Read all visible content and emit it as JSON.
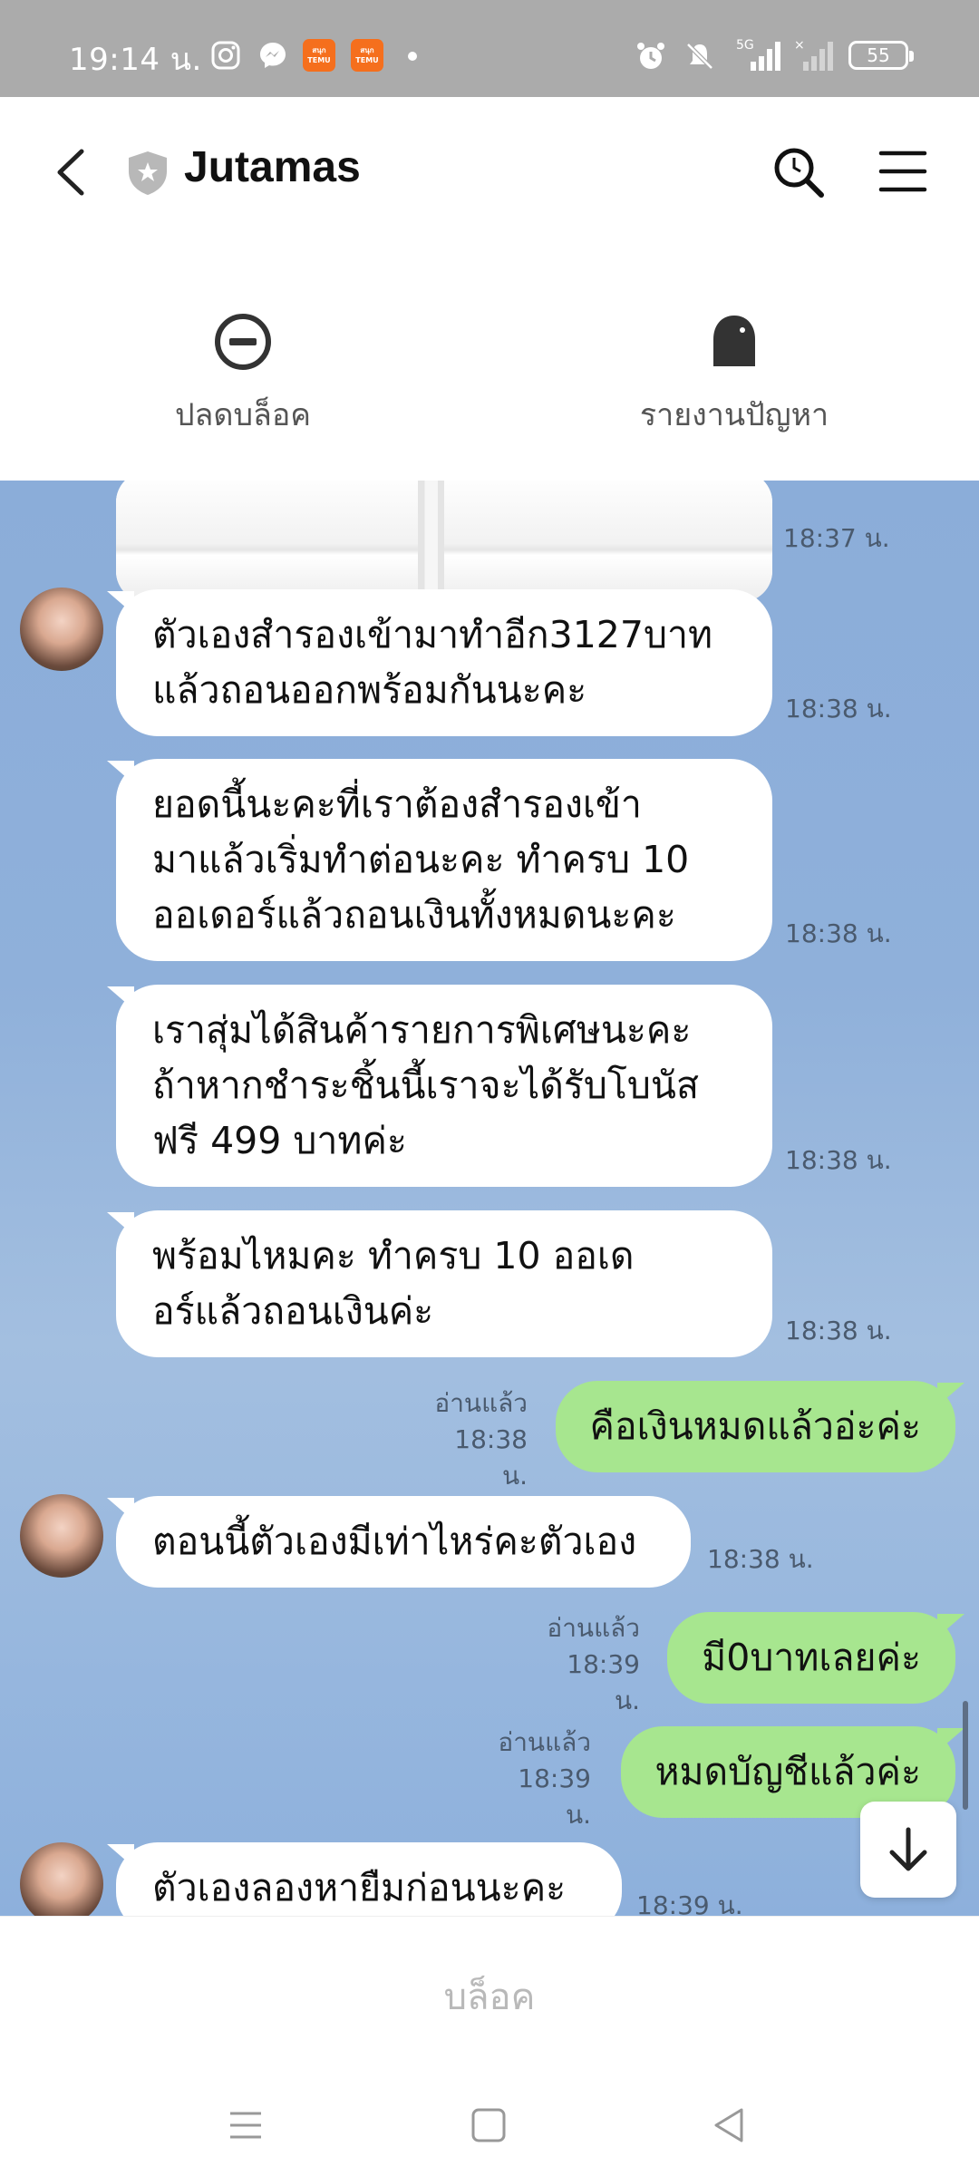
{
  "status_bar": {
    "time": "19:14 น.",
    "battery": "55",
    "network": "5G",
    "temu_label": "สนุกTEMU"
  },
  "header": {
    "title": "Jutamas"
  },
  "actions": {
    "unblock_label": "ปลดบล็อค",
    "report_label": "รายงานปัญหา"
  },
  "messages": [
    {
      "type": "image",
      "time": "18:37 น."
    },
    {
      "type": "in",
      "lines": [
        "ตัวเองสำรองเข้ามาทำอีก3127บาท",
        "แล้วถอนออกพร้อมกันนะคะ"
      ],
      "time": "18:38 น."
    },
    {
      "type": "in",
      "lines": [
        "ยอดนี้นะคะที่เราต้องสำรองเข้า",
        "มาแล้วเริ่มทำต่อนะคะ ทำครบ 10",
        "ออเดอร์แล้วถอนเงินทั้งหมดนะคะ"
      ],
      "time": "18:38 น."
    },
    {
      "type": "in",
      "lines": [
        "เราสุ่มได้สินค้ารายการพิเศษนะคะ",
        "ถ้าหากชำระชิ้นนี้เราจะได้รับโบนัส",
        "ฟรี 499 บาทค่ะ"
      ],
      "time": "18:38 น."
    },
    {
      "type": "in",
      "lines": [
        "พร้อมไหมคะ ทำครบ 10 ออเด",
        "อร์แล้วถอนเงินค่ะ"
      ],
      "time": "18:38 น."
    },
    {
      "type": "out",
      "text": "คือเงินหมดแล้วอ่ะค่ะ",
      "read": "อ่านแล้ว",
      "time": "18:38 น."
    },
    {
      "type": "in",
      "text": "ตอนนี้ตัวเองมีเท่าไหร่คะตัวเอง",
      "time": "18:38 น."
    },
    {
      "type": "out",
      "text": "มี0บาทเลยค่ะ",
      "read": "อ่านแล้ว",
      "time": "18:39 น."
    },
    {
      "type": "out",
      "text": "หมดบัญชีแล้วค่ะ",
      "read": "อ่านแล้ว",
      "time": "18:39 น."
    },
    {
      "type": "in",
      "text": "ตัวเองลองหายืมก่อนนะคะ",
      "time": "18:39 น."
    }
  ],
  "footer": {
    "block_label": "บล็อค"
  },
  "icons": {
    "back": "chevron-left-icon",
    "shield": "shield-star-icon",
    "search": "search-icon",
    "menu": "hamburger-menu-icon",
    "unblock": "minus-circle-icon",
    "report": "bell-report-icon",
    "scroll_down": "arrow-down-icon"
  },
  "colors": {
    "chat_background": "#8badd9",
    "outgoing_bubble": "#a7e68f",
    "incoming_bubble": "#ffffff",
    "status_bar": "#ababab"
  }
}
